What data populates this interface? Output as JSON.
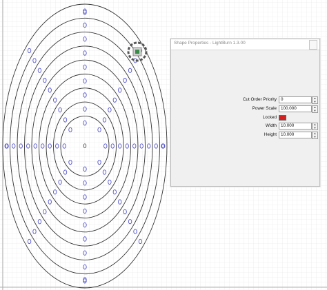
{
  "window": {
    "title": "Shape Properties - LightBurn 1.3.00"
  },
  "properties": [
    {
      "key": "cut_order",
      "label": "Cut Order Priority",
      "value": "0"
    },
    {
      "key": "power_scale",
      "label": "Power Scale",
      "value": "100.000"
    },
    {
      "key": "locked",
      "label": "Locked",
      "value": ""
    },
    {
      "key": "width",
      "label": "Width",
      "value": "10.000"
    },
    {
      "key": "height",
      "label": "Height",
      "value": "10.000"
    }
  ],
  "colors": {
    "grid_line": "#dcdcdc",
    "ellipse_stroke": "#333333",
    "node_circle": "#5555cc",
    "selection": "#555555",
    "locked_toggle": "#d42020",
    "dialog_bg": "#f0f0f0"
  },
  "icons": {
    "selected_shape": "gear-handle-icon",
    "close": "close-icon",
    "spin_up": "spin-up-icon",
    "spin_down": "spin-down-icon"
  },
  "design": {
    "ring_count": 9,
    "center_label": "0"
  }
}
